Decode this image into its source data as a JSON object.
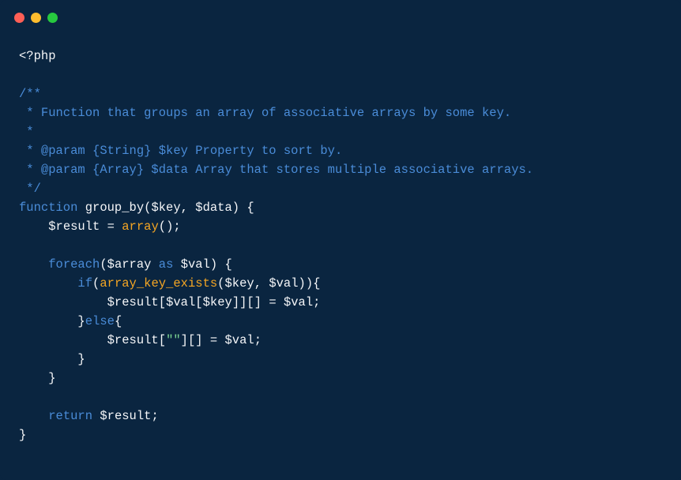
{
  "code": {
    "l1": "<?php",
    "l2": "",
    "l3": "/**",
    "l4": " * Function that groups an array of associative arrays by some key.",
    "l5": " *",
    "l6": " * @param {String} $key Property to sort by.",
    "l7": " * @param {Array} $data Array that stores multiple associative arrays.",
    "l8": " */",
    "k_function": "function",
    "fn_name": " group_by",
    "sig_open": "(",
    "p_key": "$key",
    "sig_comma": ", ",
    "p_data": "$data",
    "sig_close": ") {",
    "v_result": "$result",
    "eq": " = ",
    "call_array": "array",
    "array_after": "();",
    "k_foreach": "foreach",
    "fe_open": "(",
    "v_array": "$array",
    "k_as": " as ",
    "v_val": "$val",
    "fe_close": ") {",
    "k_if": "if",
    "if_open": "(",
    "call_ake": "array_key_exists",
    "ake_open": "(",
    "ake_mid": ", ",
    "ake_close": ")",
    "if_close": "){",
    "assign1_a": "[",
    "assign1_b": "[",
    "assign1_c": "]][]",
    "assign1_eq": " = ",
    "semi": ";",
    "brace_c": "}",
    "k_else": "else",
    "else_open": "{",
    "str_empty": "\"\"",
    "assign2_a": "[",
    "assign2_b": "][]",
    "k_return": "return",
    "sp": " "
  }
}
